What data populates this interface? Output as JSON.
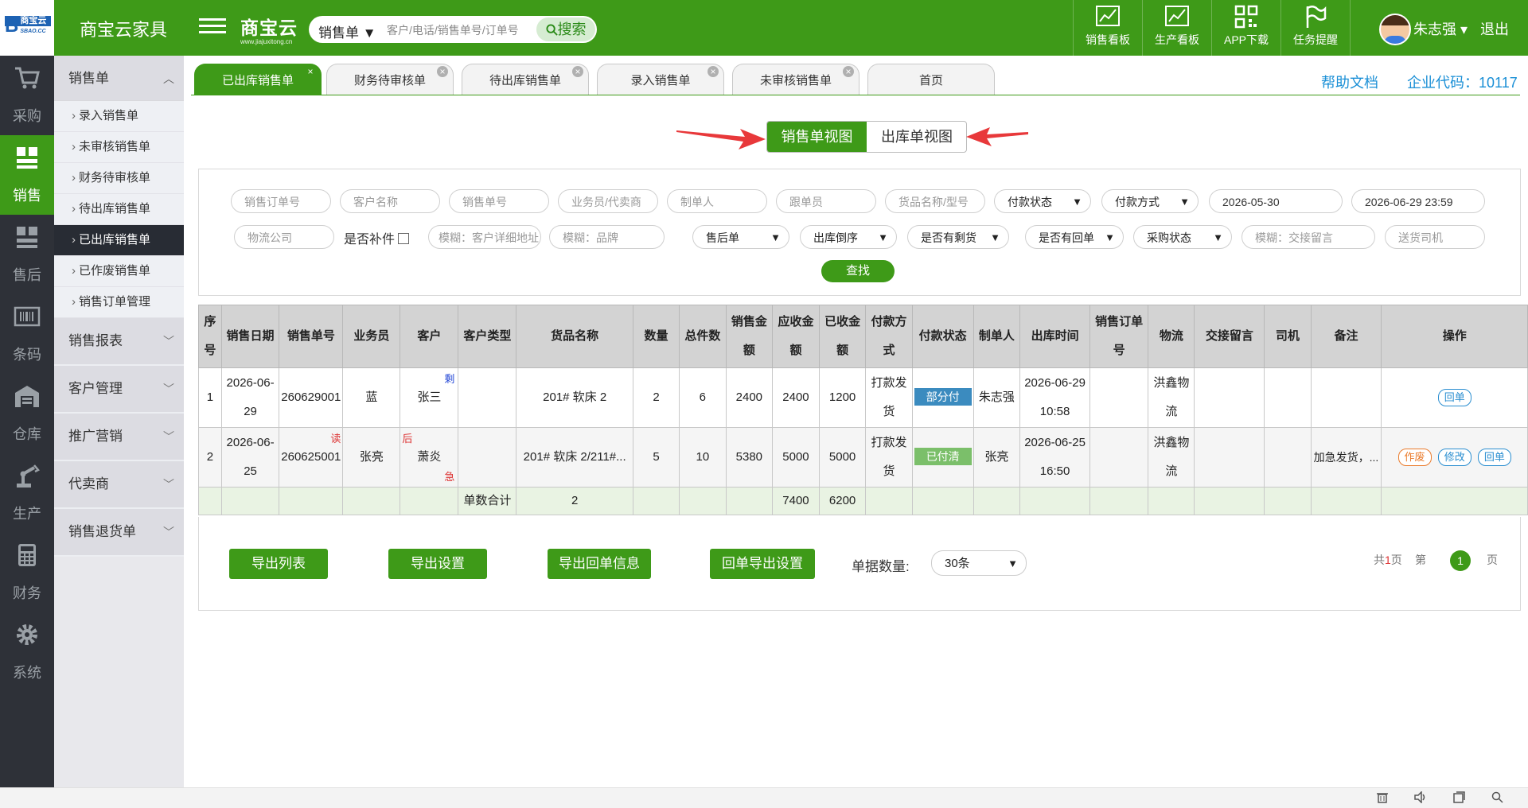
{
  "app": {
    "logo_text": "商宝云",
    "company": "商宝云家具",
    "brand_cn": "商宝云",
    "brand_url": "www.jiajuxitong.cn"
  },
  "search": {
    "type_label": "销售单 ▼",
    "placeholder": "客户/电话/销售单号/订单号",
    "button_label": "搜索"
  },
  "top_nav": [
    {
      "label": "销售看板",
      "icon": "chart-line-icon"
    },
    {
      "label": "生产看板",
      "icon": "chart-line-icon"
    },
    {
      "label": "APP下载",
      "icon": "qrcode-icon"
    },
    {
      "label": "任务提醒",
      "icon": "flag-icon"
    }
  ],
  "user": {
    "name": "朱志强 ▾",
    "logout": "退出"
  },
  "left_nav": [
    {
      "label": "采购",
      "icon": "cart-icon"
    },
    {
      "label": "销售",
      "icon": "sales-icon",
      "active": true
    },
    {
      "label": "售后",
      "icon": "aftersale-icon"
    },
    {
      "label": "条码",
      "icon": "barcode-icon"
    },
    {
      "label": "仓库",
      "icon": "warehouse-icon"
    },
    {
      "label": "生产",
      "icon": "production-icon"
    },
    {
      "label": "财务",
      "icon": "finance-icon"
    },
    {
      "label": "系统",
      "icon": "gear-icon"
    }
  ],
  "sidebar": {
    "head": "销售单",
    "items": [
      {
        "label": "录入销售单"
      },
      {
        "label": "未审核销售单"
      },
      {
        "label": "财务待审核单"
      },
      {
        "label": "待出库销售单"
      },
      {
        "label": "已出库销售单",
        "active": true
      },
      {
        "label": "已作废销售单"
      },
      {
        "label": "销售订单管理"
      }
    ],
    "groups": [
      {
        "label": "销售报表"
      },
      {
        "label": "客户管理"
      },
      {
        "label": "推广营销"
      },
      {
        "label": "代卖商"
      },
      {
        "label": "销售退货单"
      }
    ]
  },
  "tabs": [
    {
      "label": "已出库销售单",
      "active": true
    },
    {
      "label": "财务待审核单"
    },
    {
      "label": "待出库销售单"
    },
    {
      "label": "录入销售单"
    },
    {
      "label": "未审核销售单"
    },
    {
      "label": "首页"
    }
  ],
  "help_label": "帮助文档",
  "corp_label": "企业代码：10117",
  "view_toggle": {
    "sales_view": "销售单视图",
    "outbound_view": "出库单视图"
  },
  "filters": {
    "row1": [
      "销售订单号",
      "客户名称",
      "销售单号",
      "业务员/代卖商",
      "制单人",
      "跟单员",
      "货品名称/型号"
    ],
    "pay_status": "付款状态",
    "pay_method": "付款方式",
    "date_from": "2026-05-30",
    "date_to": "2026-06-29 23:59",
    "logistics": "物流公司",
    "supplement_label": "是否补件",
    "addr_ph": "模糊：客户详细地址",
    "brand_ph": "模糊：品牌",
    "aftersale": "售后单",
    "outbound_order": "出库倒序",
    "remaining": "是否有剩货",
    "receipt": "是否有回单",
    "purchase": "采购状态",
    "note_ph": "模糊：交接留言",
    "driver_ph": "送货司机",
    "find_label": "查找"
  },
  "table": {
    "headers": [
      "序号",
      "销售日期",
      "销售单号",
      "业务员",
      "客户",
      "客户类型",
      "货品名称",
      "数量",
      "总件数",
      "销售金额",
      "应收金额",
      "已收金额",
      "付款方式",
      "付款状态",
      "制单人",
      "出库时间",
      "销售订单号",
      "物流",
      "交接留言",
      "司机",
      "备注",
      "操作"
    ],
    "rows": [
      {
        "no": "1",
        "date": "2026-06-29",
        "order_no": "260629001",
        "sales": "蓝",
        "customer": "张三",
        "tag_right": "剩",
        "tag_left": "",
        "tag_left_bottom": "",
        "tag_order": "",
        "cust_type": "",
        "goods": "201# 软床 2",
        "qty": "2",
        "pieces": "6",
        "sale_amt": "2400",
        "recv_amt": "2400",
        "paid_amt": "1200",
        "pay_method": "打款发货",
        "pay_status": "部分付",
        "maker": "朱志强",
        "out_time": "2026-06-29 10:58",
        "so_no": "",
        "logistics": "洪鑫物流",
        "note_msg": "",
        "driver": "",
        "remark": "",
        "ops": [
          "回单"
        ]
      },
      {
        "no": "2",
        "date": "2026-06-25",
        "order_no": "260625001",
        "sales": "张亮",
        "customer": "萧炎",
        "tag_order": "读",
        "tag_left": "后",
        "tag_left_bottom": "急",
        "tag_right": "",
        "cust_type": "",
        "goods": "201# 软床 2/211#...",
        "qty": "5",
        "pieces": "10",
        "sale_amt": "5380",
        "recv_amt": "5000",
        "paid_amt": "5000",
        "pay_method": "打款发货",
        "pay_status": "已付清",
        "maker": "张亮",
        "out_time": "2026-06-25 16:50",
        "so_no": "",
        "logistics": "洪鑫物流",
        "note_msg": "",
        "driver": "",
        "remark": "加急发货，...",
        "ops": [
          "作废",
          "修改",
          "回单"
        ]
      }
    ],
    "summary": {
      "label": "单数合计",
      "count": "2",
      "recv_total": "7400",
      "paid_total": "6200"
    }
  },
  "bottom": {
    "buttons": [
      "导出列表",
      "导出设置",
      "导出回单信息",
      "回单导出设置"
    ],
    "count_label": "单据数量:",
    "count_value": "30条",
    "total_pages_prefix": "共",
    "total_pages_num": "1",
    "total_pages_suffix": "页",
    "page_prefix": "第",
    "current_page": "1",
    "page_suffix": "页"
  },
  "colors": {
    "brand_green": "#3e9a18",
    "dark_nav": "#2e3138",
    "link_blue": "#1a8fd6",
    "arrow_red": "#e8383a"
  }
}
